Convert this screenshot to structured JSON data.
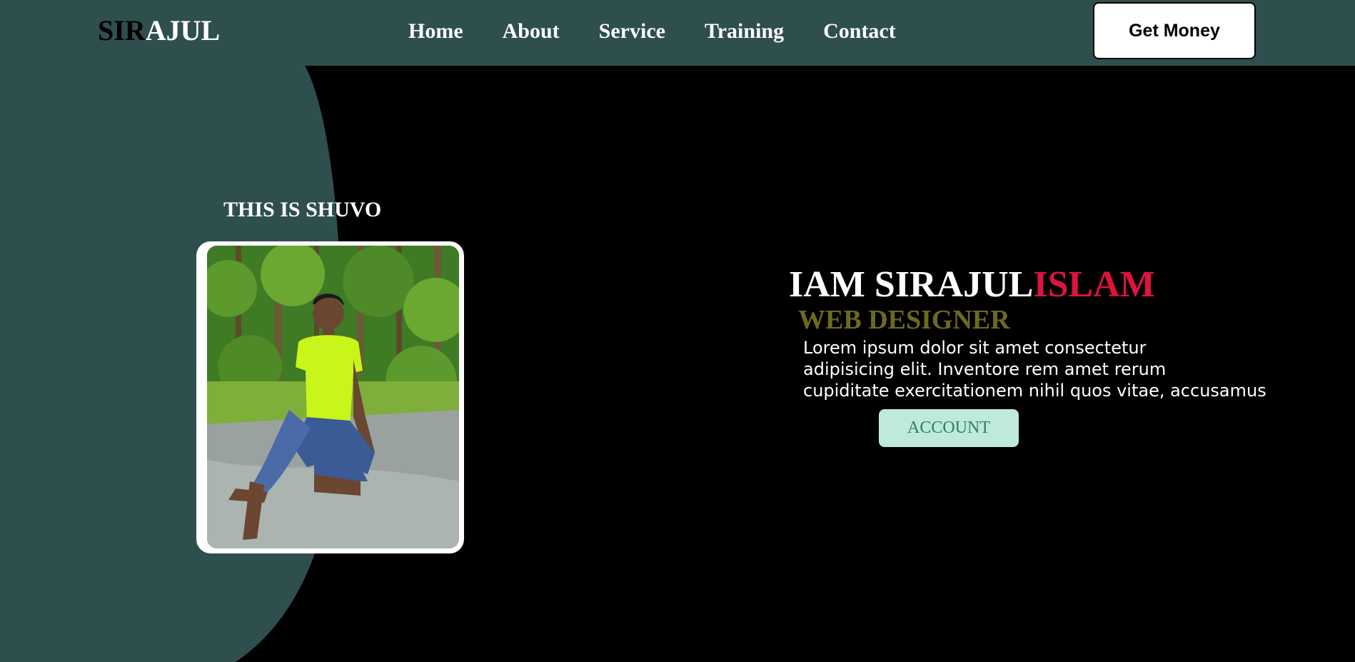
{
  "header": {
    "logo": {
      "part1": "SIR",
      "part2": "AJUL"
    },
    "nav": [
      "Home",
      "About",
      "Service",
      "Training",
      "Contact"
    ],
    "cta_label": "Get Money"
  },
  "profile": {
    "title": "THIS IS SHUVO",
    "photo_icon": "person-photo"
  },
  "hero": {
    "heading_main": "IAM SIRAJUL",
    "heading_accent": "ISLAM",
    "role": "WEB DESIGNER",
    "text_lines": [
      "Lorem ipsum dolor sit amet consectetur",
      "adipisicing elit. Inventore rem amet rerum",
      "cupiditate exercitationem nihil quos vitae, accusamus"
    ],
    "button_label": "ACCOUNT"
  },
  "colors": {
    "header_bg": "#2f4f4f",
    "page_bg": "#000000",
    "accent_red": "#dc143c",
    "role_olive": "#6b6b1f",
    "button_mint": "#bfeadb"
  }
}
